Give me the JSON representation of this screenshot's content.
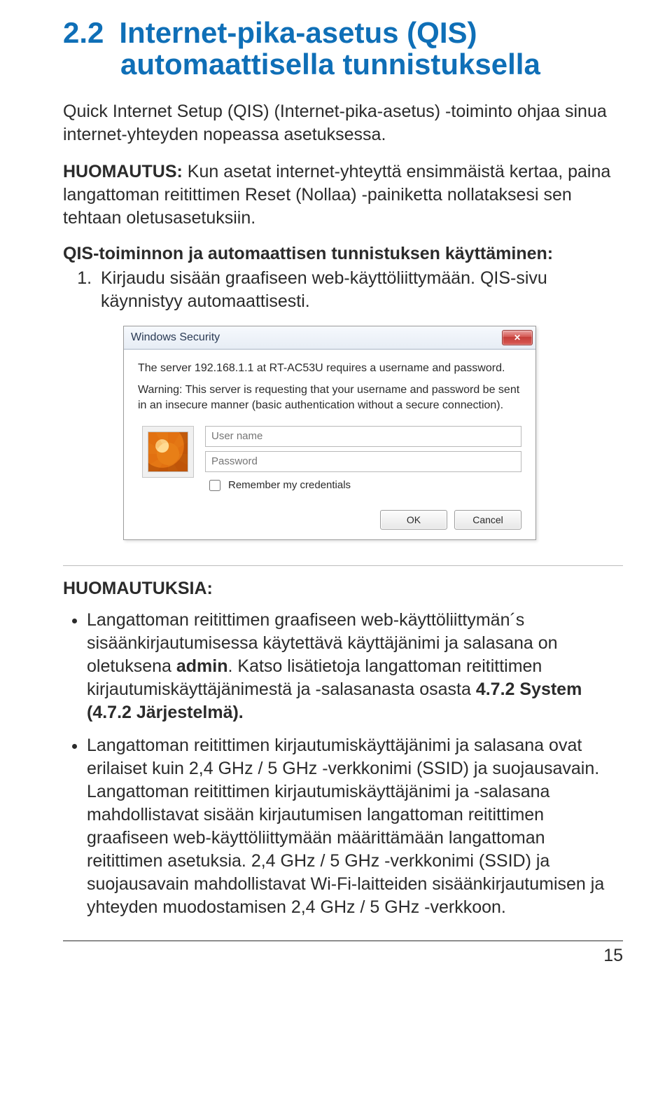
{
  "heading": {
    "number": "2.2",
    "line1": "Internet-pika-asetus (QIS)",
    "line2": "automaattisella tunnistuksella"
  },
  "intro": "Quick Internet Setup (QIS) (Internet-pika-asetus) -toiminto ohjaa sinua internet-yhteyden nopeassa asetuksessa.",
  "note1": {
    "label": "HUOMAUTUS:",
    "text": " Kun asetat internet-yhteyttä ensimmäistä kertaa, paina langattoman reitittimen  Reset (Nollaa) -painiketta nollataksesi sen tehtaan oletusasetuksiin."
  },
  "steps_heading": "QIS-toiminnon ja automaattisen tunnistuksen käyttäminen:",
  "step1": "Kirjaudu sisään graafiseen web-käyttöliittymään. QIS-sivu käynnistyy automaattisesti.",
  "dialog": {
    "title": "Windows Security",
    "msg1": "The server 192.168.1.1 at RT-AC53U requires a username and password.",
    "msg2": "Warning: This server is requesting that your username and password be sent in an insecure manner (basic authentication without a secure connection).",
    "user_placeholder": "User name",
    "pass_placeholder": "Password",
    "remember": "Remember my credentials",
    "ok": "OK",
    "cancel": "Cancel"
  },
  "notes_heading": "HUOMAUTUKSIA",
  "notes": {
    "a_pre": "Langattoman reitittimen graafiseen web-käyttöliittymän´s sisäänkirjautumisessa käytettävä käyttäjänimi ja salasana on oletuksena ",
    "a_bold1": "admin",
    "a_mid": ". Katso lisätietoja langattoman reitittimen kirjautumiskäyttäjänimestä ja -salasanasta osasta ",
    "a_bold2": "4.7.2 System (4.7.2 Järjestelmä).",
    "b": "Langattoman reitittimen kirjautumiskäyttäjänimi ja salasana ovat erilaiset kuin 2,4 GHz / 5 GHz -verkkonimi (SSID) ja suojausavain. Langattoman reitittimen kirjautumiskäyttäjänimi ja -salasana mahdollistavat sisään kirjautumisen langattoman reitittimen graafiseen web-käyttöliittymään määrittämään langattoman reitittimen asetuksia. 2,4 GHz / 5 GHz -verkkonimi (SSID) ja suojausavain mahdollistavat Wi-Fi-laitteiden sisäänkirjautumisen ja yhteyden muodostamisen 2,4 GHz / 5 GHz -verkkoon."
  },
  "page_number": "15"
}
